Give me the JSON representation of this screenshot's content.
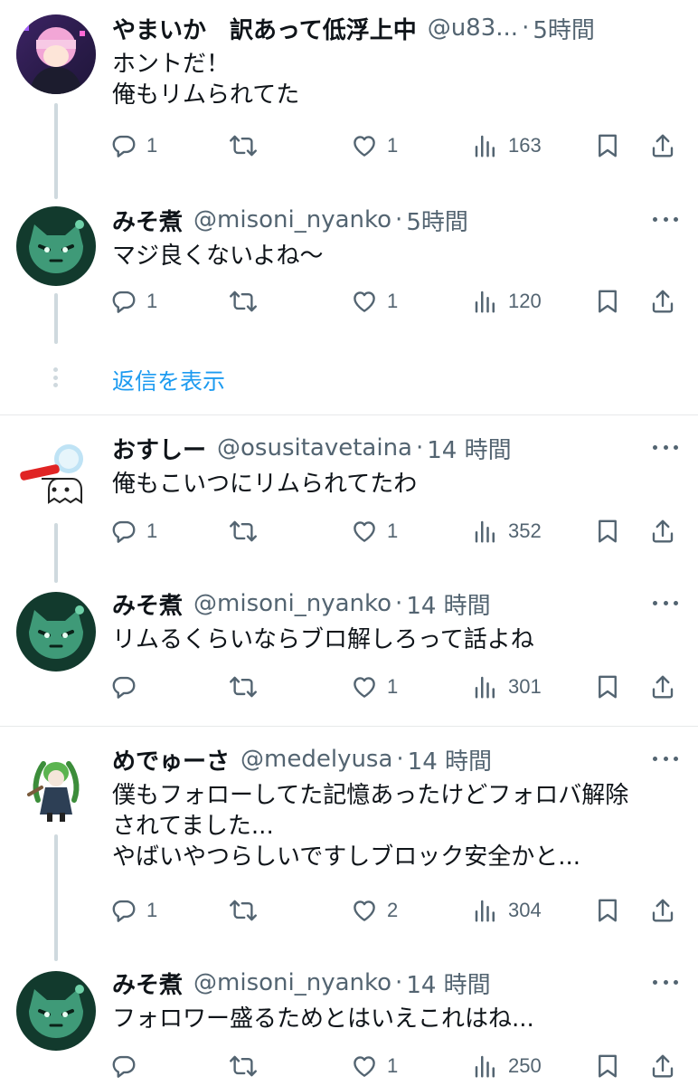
{
  "tweets": [
    {
      "name": "やまいか　訳あって低浮上中",
      "handle": "@u83...",
      "time": "5時間",
      "text": "ホントだ！\n俺もリムられてた",
      "replies": "1",
      "likes": "1",
      "views": "163",
      "avatar": "pink-hair-avatar"
    },
    {
      "name": "みそ煮",
      "handle": "@misoni_nyanko",
      "time": "5時間",
      "text": "マジ良くないよね〜",
      "replies": "1",
      "likes": "1",
      "views": "120",
      "avatar": "green-cat-avatar"
    },
    {
      "name": "おすしー",
      "handle": "@osusitavetaina",
      "time": "14 時間",
      "text": "俺もこいつにリムられてたわ",
      "replies": "1",
      "likes": "1",
      "views": "352",
      "avatar": "white-ghost-avatar"
    },
    {
      "name": "みそ煮",
      "handle": "@misoni_nyanko",
      "time": "14 時間",
      "text": "リムるくらいならブロ解しろって話よね",
      "replies": "",
      "likes": "1",
      "views": "301",
      "avatar": "green-cat-avatar"
    },
    {
      "name": "めでゅーさ",
      "handle": "@medelyusa",
      "time": "14 時間",
      "text": "僕もフォローしてた記憶あったけどフォロバ解除\nされてました...\nやばいやつらしいですしブロック安全かと...",
      "replies": "1",
      "likes": "2",
      "views": "304",
      "avatar": "green-hair-character-avatar"
    },
    {
      "name": "みそ煮",
      "handle": "@misoni_nyanko",
      "time": "14 時間",
      "text": "フォロワー盛るためとはいえこれはね...",
      "replies": "",
      "likes": "1",
      "views": "250",
      "avatar": "green-cat-avatar"
    }
  ],
  "show_replies_label": "返信を表示",
  "dot_separator": "·",
  "colors": {
    "text": "#0f1419",
    "secondary": "#536471",
    "accent": "#1d9bf0",
    "line": "#cfd9de",
    "divider": "#e7e9ea"
  },
  "icons": [
    "reply-icon",
    "retweet-icon",
    "like-icon",
    "views-icon",
    "bookmark-icon",
    "share-icon",
    "more-icon"
  ]
}
